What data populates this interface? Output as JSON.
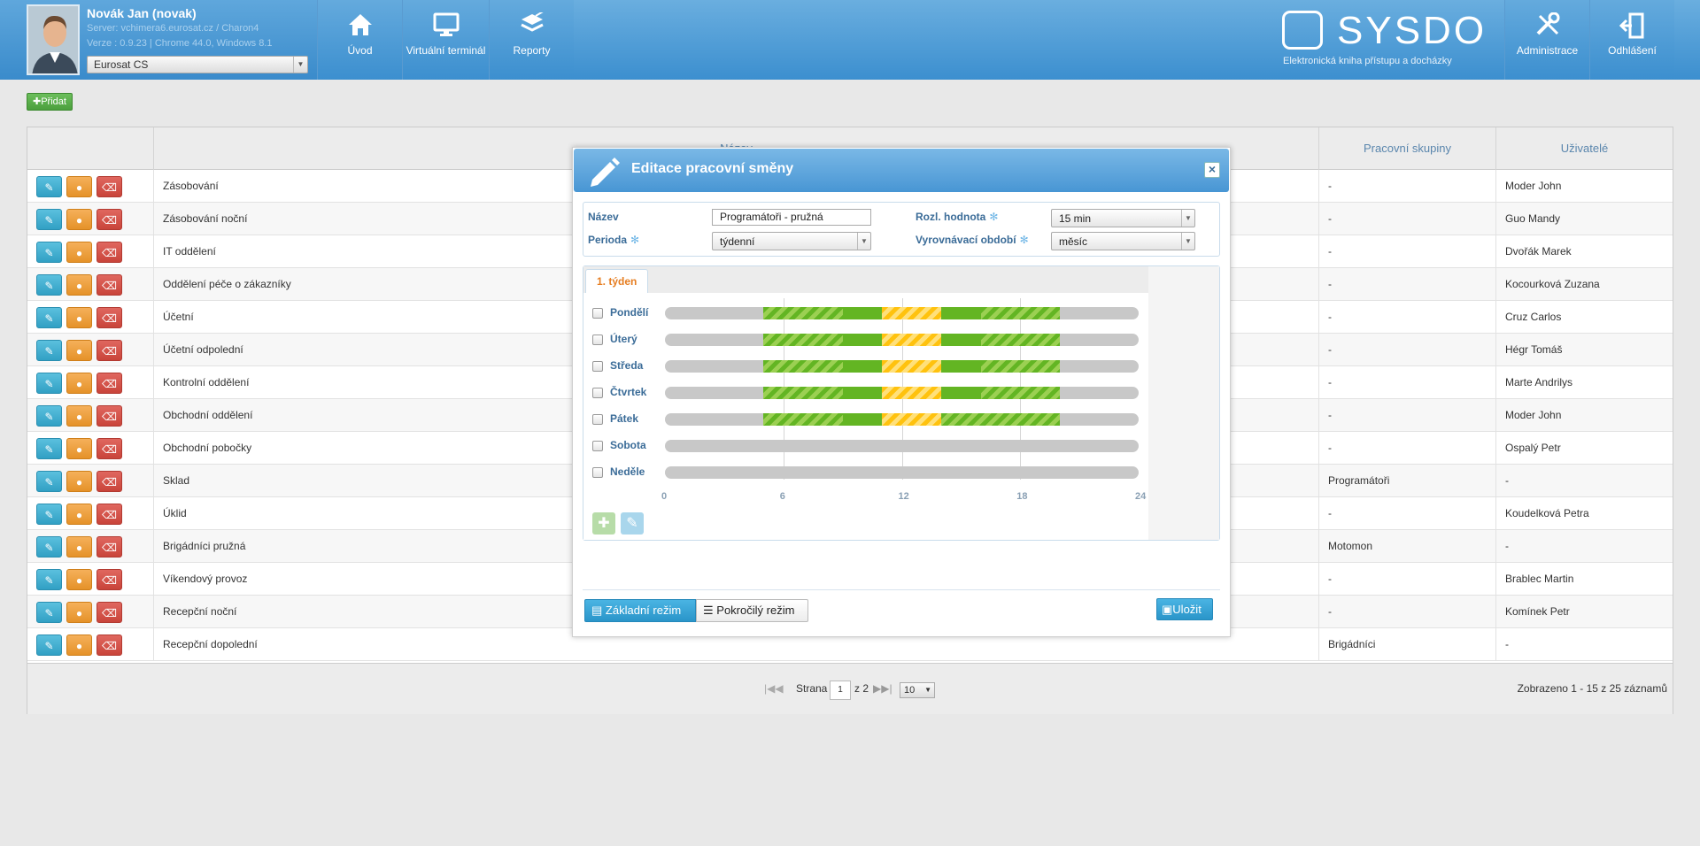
{
  "header": {
    "user_name": "Novák Jan (novak)",
    "server": "Server: vchimera6.eurosat.cz / Charon4",
    "version": "Verze : 0.9.23 | Chrome 44.0, Windows 8.1",
    "company": "Eurosat CS",
    "nav": [
      {
        "label": "Úvod",
        "icon": "home-icon"
      },
      {
        "label": "Virtuální terminál",
        "icon": "monitor-icon"
      },
      {
        "label": "Reporty",
        "icon": "report-icon"
      }
    ],
    "logo_text": "SYSDO",
    "logo_subtitle": "Elektronická kniha přístupu a docházky",
    "admin_label": "Administrace",
    "logout_label": "Odhlášení"
  },
  "toolbar": {
    "add_label": "✚Přidat"
  },
  "grid": {
    "columns": [
      "Název",
      "Pracovní skupiny",
      "Uživatelé"
    ],
    "rows": [
      {
        "name": "Zásobování",
        "groups": "-",
        "users": "Moder John"
      },
      {
        "name": "Zásobování noční",
        "groups": "-",
        "users": "Guo Mandy"
      },
      {
        "name": "IT oddělení",
        "groups": "-",
        "users": "Dvořák Marek"
      },
      {
        "name": "Oddělení péče o zákazníky",
        "groups": "-",
        "users": "Kocourková Zuzana"
      },
      {
        "name": "Účetní",
        "groups": "-",
        "users": "Cruz Carlos"
      },
      {
        "name": "Účetní odpolední",
        "groups": "-",
        "users": "Hégr Tomáš"
      },
      {
        "name": "Kontrolní oddělení",
        "groups": "-",
        "users": "Marte Andrilys"
      },
      {
        "name": "Obchodní oddělení",
        "groups": "-",
        "users": "Moder John"
      },
      {
        "name": "Obchodní pobočky",
        "groups": "-",
        "users": "Ospalý Petr"
      },
      {
        "name": "Sklad",
        "groups": "Programátoři",
        "users": "-"
      },
      {
        "name": "Úklid",
        "groups": "-",
        "users": "Koudelková Petra"
      },
      {
        "name": "Brigádníci pružná",
        "groups": "Motomon",
        "users": "-"
      },
      {
        "name": "Víkendový provoz",
        "groups": "-",
        "users": "Brablec Martin"
      },
      {
        "name": "Recepční noční",
        "groups": "-",
        "users": "Komínek Petr"
      },
      {
        "name": "Recepční dopolední",
        "groups": "Brigádníci",
        "users": "-"
      }
    ],
    "pager": {
      "page_label": "Strana",
      "page": "1",
      "of_label": "z 2",
      "page_size": "10",
      "summary": "Zobrazeno 1 - 15 z 25 záznamů"
    }
  },
  "dialog": {
    "title": "Editace pracovní směny",
    "name_label": "Název",
    "name_value": "Programátoři - pružná",
    "period_label": "Perioda",
    "period_value": "týdenní",
    "round_label": "Rozl. hodnota",
    "round_value": "15 min",
    "balance_label": "Vyrovnávací období",
    "balance_value": "měsíc",
    "tab_label": "1. týden",
    "days": [
      {
        "name": "Pondělí",
        "segments": [
          [
            "flex",
            5,
            9
          ],
          [
            "fix",
            9,
            11
          ],
          [
            "break",
            11,
            14
          ],
          [
            "fix",
            14,
            16
          ],
          [
            "flex",
            16,
            20
          ]
        ]
      },
      {
        "name": "Úterý",
        "segments": [
          [
            "flex",
            5,
            9
          ],
          [
            "fix",
            9,
            11
          ],
          [
            "break",
            11,
            14
          ],
          [
            "fix",
            14,
            16
          ],
          [
            "flex",
            16,
            20
          ]
        ]
      },
      {
        "name": "Středa",
        "segments": [
          [
            "flex",
            5,
            9
          ],
          [
            "fix",
            9,
            11
          ],
          [
            "break",
            11,
            14
          ],
          [
            "fix",
            14,
            16
          ],
          [
            "flex",
            16,
            20
          ]
        ]
      },
      {
        "name": "Čtvrtek",
        "segments": [
          [
            "flex",
            5,
            9
          ],
          [
            "fix",
            9,
            11
          ],
          [
            "break",
            11,
            14
          ],
          [
            "fix",
            14,
            16
          ],
          [
            "flex",
            16,
            20
          ]
        ]
      },
      {
        "name": "Pátek",
        "segments": [
          [
            "flex",
            5,
            9
          ],
          [
            "fix",
            9,
            11
          ],
          [
            "break",
            11,
            14
          ],
          [
            "flex",
            14,
            20
          ]
        ]
      },
      {
        "name": "Sobota",
        "segments": []
      },
      {
        "name": "Neděle",
        "segments": []
      }
    ],
    "axis": [
      "0",
      "6",
      "12",
      "18",
      "24"
    ],
    "mode_basic": "Základní režim",
    "mode_advanced": "Pokročilý režim",
    "save_label": "Uložit",
    "colors": {
      "fixed": "#63b523",
      "flex": "#9bd052",
      "break": "#ffc20e",
      "empty": "#c8c8c8"
    }
  }
}
